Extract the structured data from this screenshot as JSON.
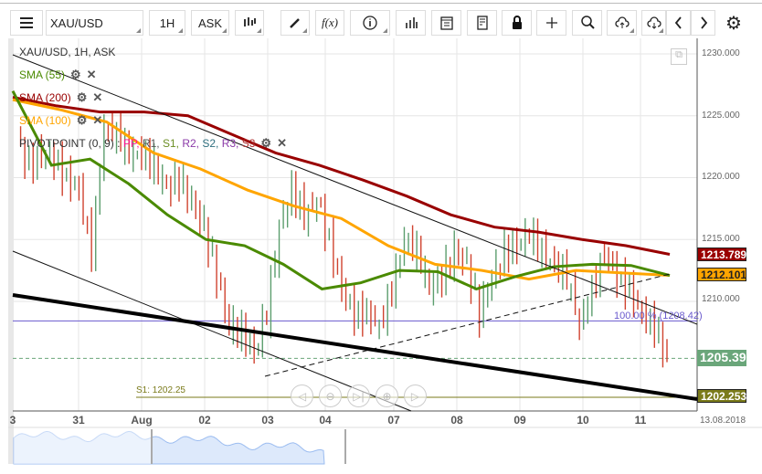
{
  "toolbar": {
    "symbol": "XAU/USD",
    "timeframe": "1H",
    "price_type": "ASK"
  },
  "chart": {
    "title": "XAU/USD, 1H, ASK",
    "indicators": [
      {
        "label": "SMA (55)",
        "color": "#4a8a00"
      },
      {
        "label": "SMA (200)",
        "color": "#990000"
      },
      {
        "label": "SMA (100)",
        "color": "#ffa500"
      }
    ],
    "pivot": {
      "label": "PIVOTPOINT (0, 9)",
      "sep": " : ",
      "parts": [
        {
          "t": "PP",
          "c": "#ff1493"
        },
        {
          "t": "R1",
          "c": "#555"
        },
        {
          "t": "S1",
          "c": "#6b8e23"
        },
        {
          "t": "R2",
          "c": "#8b3aa8"
        },
        {
          "t": "S2",
          "c": "#2f6f7f"
        },
        {
          "t": "R3",
          "c": "#8b3aa8"
        },
        {
          "t": "S3",
          "c": "#b03030"
        }
      ]
    },
    "y_ticks": [
      "1230.000",
      "1225.000",
      "1220.000",
      "1215.000",
      "1210.000"
    ],
    "y_tick_values": [
      1230,
      1225,
      1220,
      1215,
      1210
    ],
    "x_ticks": [
      "3",
      "31",
      "Aug",
      "02",
      "03",
      "04",
      "07",
      "08",
      "09",
      "10",
      "11"
    ],
    "date_label": "13.08.2018",
    "fib_label": "100.00 % (1208.42)",
    "fib_value": 1208.42,
    "s1_label": "S1: 1202.25",
    "s1_value": 1202.25,
    "price_tags": [
      {
        "value": "1213.789",
        "bg": "#990000"
      },
      {
        "value": "1212.101",
        "bg": "#ffa500"
      },
      {
        "value": "1205.392",
        "bg": "#6aa67a"
      },
      {
        "value": "1202.253",
        "bg": "#7a7a1a"
      }
    ],
    "closes": [
      1223,
      1221,
      1222,
      1221.5,
      1220,
      1219,
      1214,
      1224,
      1223.5,
      1222,
      1222,
      1221,
      1219,
      1220,
      1218,
      1216,
      1212,
      1208,
      1207.5,
      1206,
      1209,
      1216,
      1219,
      1217,
      1218,
      1215,
      1211,
      1209,
      1209,
      1208,
      1211,
      1215,
      1214,
      1211,
      1212,
      1214,
      1213,
      1209,
      1212,
      1214,
      1214.5,
      1215.5,
      1214,
      1213,
      1212,
      1208,
      1211,
      1214,
      1212,
      1211,
      1209,
      1208,
      1205.4
    ],
    "sma55": [
      1227,
      1221,
      1221.5,
      1219.5,
      1217,
      1215,
      1214.5,
      1213,
      1211,
      1211.5,
      1212.5,
      1212.4,
      1211,
      1212,
      1212.8,
      1213,
      1212.9,
      1212.1
    ],
    "sma100": [
      1226.3,
      1225.5,
      1224.5,
      1222,
      1220.7,
      1219,
      1217.7,
      1216.7,
      1214.5,
      1213,
      1212.5,
      1211.8,
      1212.5,
      1212.3,
      1212.1
    ],
    "sma200": [
      1226.5,
      1225.8,
      1225.3,
      1225.3,
      1225,
      1223.5,
      1222,
      1221,
      1219.8,
      1218.5,
      1217,
      1216,
      1215.6,
      1215,
      1214.5,
      1213.8
    ]
  }
}
